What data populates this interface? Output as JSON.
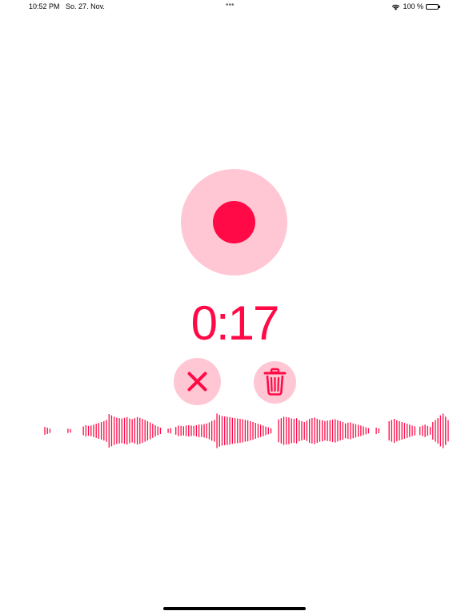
{
  "status_bar": {
    "time": "10:52 PM",
    "date": "So. 27. Nov.",
    "multitask_dots": "•••",
    "battery_percent": "100 %",
    "battery_level": 1.0
  },
  "recorder": {
    "elapsed": "0:17",
    "is_recording": true
  },
  "icons": {
    "record": "record-dot-icon",
    "cancel": "x-mark-icon",
    "delete": "trash-icon",
    "wifi": "wifi-icon",
    "battery": "battery-icon"
  },
  "colors": {
    "accent": "#ff0a46",
    "accent_soft": "#ffc7d3",
    "background": "#ffffff"
  },
  "waveform": {
    "levels": [
      0.22,
      0.18,
      0.12,
      0,
      0,
      0,
      0,
      0,
      0,
      0.12,
      0.1,
      0,
      0,
      0,
      0,
      0.25,
      0.32,
      0.28,
      0.3,
      0.35,
      0.4,
      0.45,
      0.5,
      0.55,
      0.62,
      0.95,
      0.88,
      0.8,
      0.75,
      0.72,
      0.7,
      0.74,
      0.78,
      0.7,
      0.66,
      0.72,
      0.78,
      0.74,
      0.68,
      0.62,
      0.55,
      0.48,
      0.4,
      0.32,
      0.25,
      0.18,
      0,
      0,
      0.12,
      0.15,
      0,
      0.22,
      0.3,
      0.28,
      0.26,
      0.3,
      0.32,
      0.3,
      0.28,
      0.32,
      0.36,
      0.35,
      0.38,
      0.42,
      0.48,
      0.56,
      0.62,
      0.98,
      0.9,
      0.84,
      0.82,
      0.8,
      0.78,
      0.74,
      0.72,
      0.7,
      0.68,
      0.66,
      0.62,
      0.6,
      0.55,
      0.5,
      0.45,
      0.4,
      0.35,
      0.3,
      0.24,
      0.2,
      0.15,
      0,
      0,
      0.65,
      0.72,
      0.8,
      0.78,
      0.76,
      0.7,
      0.68,
      0.72,
      0.6,
      0.55,
      0.5,
      0.58,
      0.68,
      0.72,
      0.75,
      0.68,
      0.62,
      0.6,
      0.55,
      0.58,
      0.6,
      0.64,
      0.66,
      0.6,
      0.55,
      0.5,
      0.42,
      0.46,
      0.48,
      0.42,
      0.38,
      0.34,
      0.3,
      0.25,
      0.2,
      0.15,
      0,
      0,
      0.18,
      0.14,
      0,
      0,
      0,
      0.55,
      0.62,
      0.68,
      0.6,
      0.55,
      0.5,
      0.45,
      0.4,
      0.35,
      0.3,
      0.26,
      0,
      0.24,
      0.3,
      0.35,
      0.28,
      0.22,
      0.5,
      0.62,
      0.72,
      0.88,
      0.98,
      0.8,
      0.6
    ]
  }
}
